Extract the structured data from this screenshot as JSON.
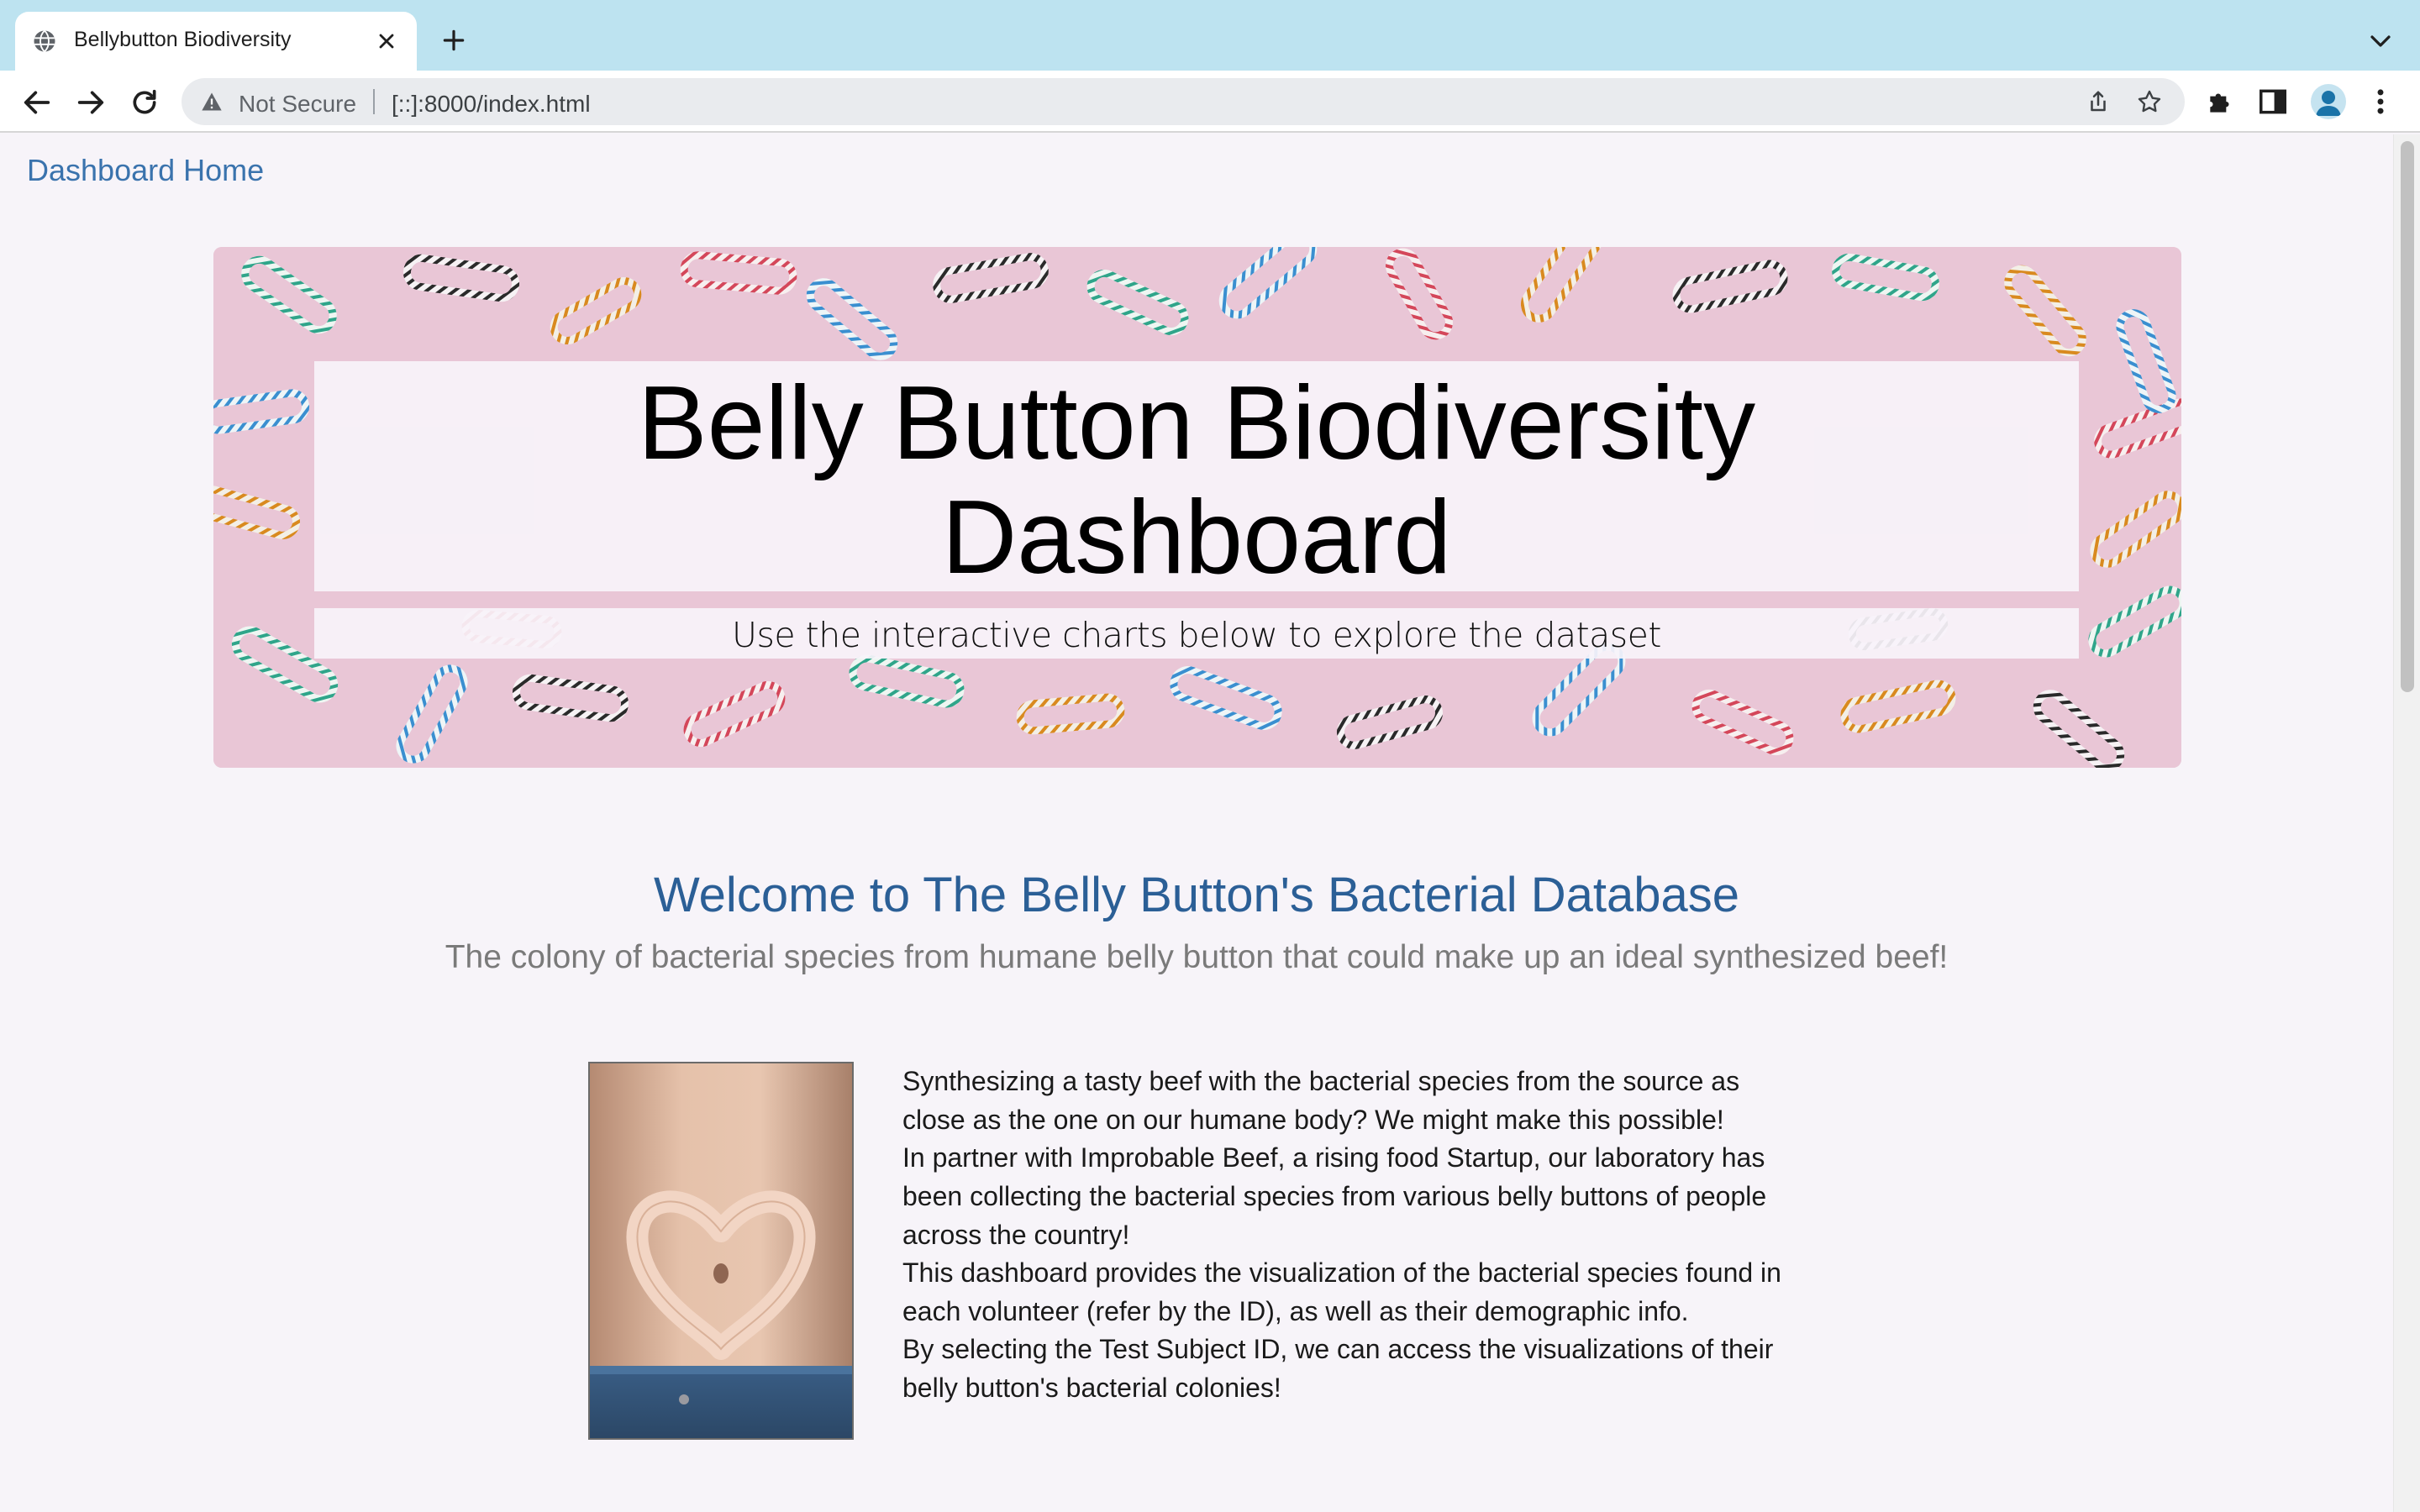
{
  "browser": {
    "tab_title": "Bellybutton Biodiversity",
    "security_label": "Not Secure",
    "url": "[::]:8000/index.html"
  },
  "nav": {
    "home_link": "Dashboard Home"
  },
  "hero": {
    "title_line1": "Belly Button Biodiversity",
    "title_line2": "Dashboard",
    "subtitle": "Use the interactive charts below to explore the dataset"
  },
  "intro": {
    "heading": "Welcome to The Belly Button's Bacterial Database",
    "tagline": "The colony of bacterial species from humane belly button that could make up an ideal synthesized beef!",
    "p1_line1": "Synthesizing a tasty beef with the bacterial species from the source as",
    "p1_line2": "close as the one on our humane body? We might make this possible!",
    "p2_line1": "In partner with Improbable Beef, a rising food Startup, our laboratory has",
    "p2_line2": "been collecting the bacterial species from various belly buttons of people",
    "p2_line3": "across the country!",
    "p3_line1": "This dashboard provides the visualization of the bacterial species found in",
    "p3_line2": "each volunteer (refer by the ID), as well as their demographic info.",
    "p4_line1": "By selecting the Test Subject ID, we can access the visualizations of their",
    "p4_line2": "belly button's bacterial colonies!"
  },
  "colors": {
    "tabstrip": "#bde3f0",
    "link": "#3a73ad",
    "heading": "#2b5f96",
    "tagline": "#7a7a7a",
    "hero_bg": "#e6c3d3"
  },
  "icons": {
    "favicon": "globe-icon",
    "close": "close-icon",
    "new_tab": "plus-icon",
    "back": "arrow-left-icon",
    "forward": "arrow-right-icon",
    "reload": "reload-icon",
    "security": "warning-icon",
    "share": "share-icon",
    "bookmark": "star-icon",
    "extensions": "puzzle-icon",
    "side_panel": "side-panel-icon",
    "profile": "avatar",
    "menu": "kebab-menu-icon"
  }
}
